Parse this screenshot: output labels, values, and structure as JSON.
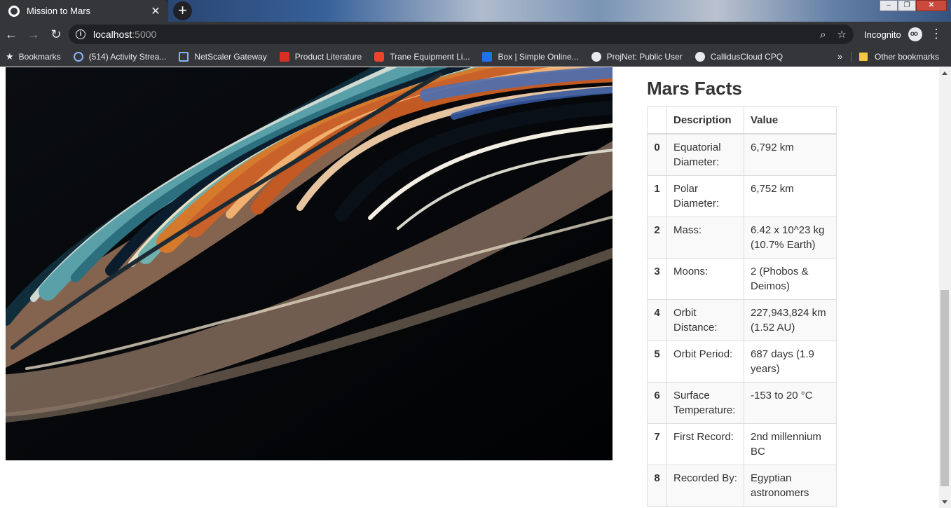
{
  "browser": {
    "tab_title": "Mission to Mars",
    "new_tab_symbol": "+",
    "url_host": "localhost",
    "url_port": ":5000",
    "incognito_label": "Incognito"
  },
  "bookmarks": {
    "items": [
      {
        "label": "Bookmarks",
        "icon": "star-icon"
      },
      {
        "label": "(514) Activity Strea...",
        "icon": "activity-icon",
        "color": "#8ab4f8"
      },
      {
        "label": "NetScaler Gateway",
        "icon": "lock-icon",
        "color": "#8ab4f8"
      },
      {
        "label": "Product Literature",
        "icon": "trane-icon",
        "color": "#d93025"
      },
      {
        "label": "Trane Equipment Li...",
        "icon": "trane-icon",
        "color": "#e8452c"
      },
      {
        "label": "Box | Simple Online...",
        "icon": "box-icon",
        "color": "#1a73e8"
      },
      {
        "label": "ProjNet: Public User",
        "icon": "globe-icon",
        "color": "#e8eaed"
      },
      {
        "label": "CallidusCloud CPQ",
        "icon": "globe-icon",
        "color": "#e8eaed"
      }
    ],
    "other_label": "Other bookmarks"
  },
  "mars_facts": {
    "title": "Mars Facts",
    "columns": [
      "",
      "Description",
      "Value"
    ],
    "rows": [
      {
        "index": "0",
        "description": "Equatorial Diameter:",
        "value": "6,792 km"
      },
      {
        "index": "1",
        "description": "Polar Diameter:",
        "value": "6,752 km"
      },
      {
        "index": "2",
        "description": "Mass:",
        "value": "6.42 x 10^23 kg (10.7% Earth)"
      },
      {
        "index": "3",
        "description": "Moons:",
        "value": "2 (Phobos & Deimos)"
      },
      {
        "index": "4",
        "description": "Orbit Distance:",
        "value": "227,943,824 km (1.52 AU)"
      },
      {
        "index": "5",
        "description": "Orbit Period:",
        "value": "687 days (1.9 years)"
      },
      {
        "index": "6",
        "description": "Surface Temperature:",
        "value": "-153 to 20 °C"
      },
      {
        "index": "7",
        "description": "First Record:",
        "value": "2nd millennium BC"
      },
      {
        "index": "8",
        "description": "Recorded By:",
        "value": "Egyptian astronomers"
      }
    ]
  },
  "colors": {
    "chrome_dark": "#35363a",
    "omnibox": "#202124",
    "table_border": "#dddddd",
    "text": "#333333"
  }
}
